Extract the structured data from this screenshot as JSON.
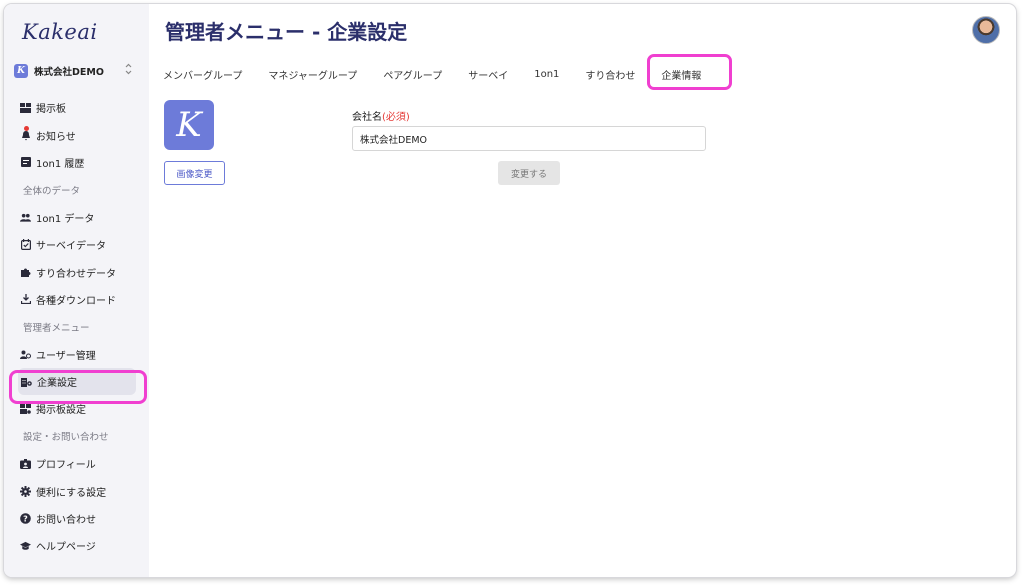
{
  "brand": "Kakeai",
  "company": {
    "logo_letter": "K",
    "name": "株式会社DEMO",
    "switch_icon": "⌃⌄"
  },
  "sidebar": {
    "main_items": [
      {
        "label": "掲示板",
        "icon": "board-icon"
      },
      {
        "label": "お知らせ",
        "icon": "bell-icon"
      },
      {
        "label": "1on1 履歴",
        "icon": "history-icon"
      }
    ],
    "section_data": "全体のデータ",
    "data_items": [
      {
        "label": "1on1 データ",
        "icon": "people-icon"
      },
      {
        "label": "サーベイデータ",
        "icon": "survey-icon"
      },
      {
        "label": "すり合わせデータ",
        "icon": "puzzle-icon"
      },
      {
        "label": "各種ダウンロード",
        "icon": "download-icon"
      }
    ],
    "section_admin": "管理者メニュー",
    "admin_items": [
      {
        "label": "ユーザー管理",
        "icon": "users-icon"
      },
      {
        "label": "企業設定",
        "icon": "company-icon"
      },
      {
        "label": "掲示板設定",
        "icon": "board-settings-icon"
      }
    ],
    "section_settings": "設定・お問い合わせ",
    "settings_items": [
      {
        "label": "プロフィール",
        "icon": "profile-icon"
      },
      {
        "label": "便利にする設定",
        "icon": "gear-icon"
      },
      {
        "label": "お問い合わせ",
        "icon": "question-icon"
      },
      {
        "label": "ヘルプページ",
        "icon": "graduation-icon"
      }
    ]
  },
  "header": {
    "title": "管理者メニュー - 企業設定"
  },
  "tabs": [
    "メンバーグループ",
    "マネジャーグループ",
    "ペアグループ",
    "サーベイ",
    "1on1",
    "すり合わせ",
    "企業情報"
  ],
  "form": {
    "logo_letter": "K",
    "image_button": "画像変更",
    "company_label": "会社名",
    "required_mark": "(必須)",
    "company_value": "株式会社DEMO",
    "submit_button": "変更する"
  },
  "colors": {
    "accent": "#6d7bd9",
    "title": "#2b2f6b",
    "highlight": "#f03fd0",
    "required": "#e53935"
  }
}
